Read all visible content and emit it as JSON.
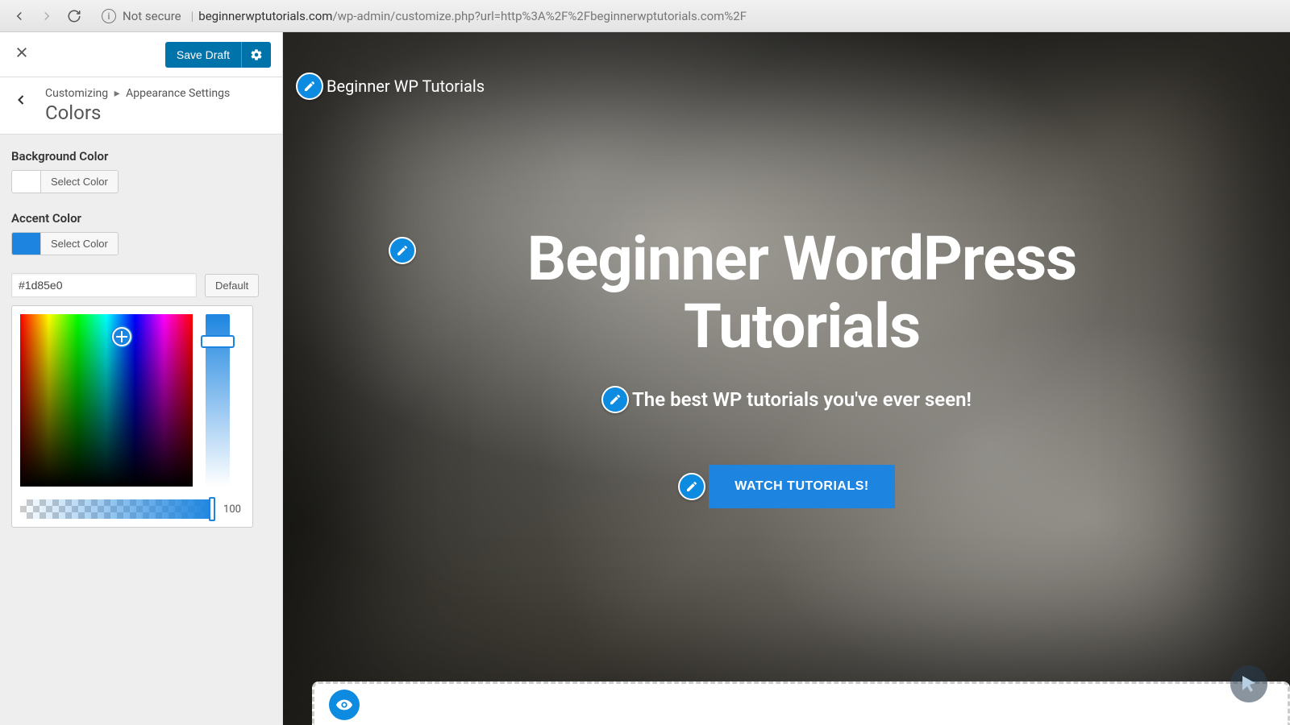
{
  "browser": {
    "not_secure": "Not secure",
    "host": "beginnerwptutorials.com",
    "path": "/wp-admin/customize.php?url=http%3A%2F%2Fbeginnerwptutorials.com%2F"
  },
  "header": {
    "save_draft": "Save Draft"
  },
  "breadcrumb": {
    "root": "Customizing",
    "parent": "Appearance Settings",
    "section": "Colors"
  },
  "controls": {
    "background": {
      "label": "Background Color",
      "select_btn": "Select Color",
      "swatch": "#ffffff"
    },
    "accent": {
      "label": "Accent Color",
      "select_btn": "Select Color",
      "swatch": "#1d85e0",
      "hex_value": "#1d85e0",
      "default_btn": "Default",
      "alpha": "100"
    }
  },
  "preview": {
    "site_title": "Beginner WP Tutorials",
    "hero_title": "Beginner WordPress Tutorials",
    "tagline": "The best WP tutorials you've ever seen!",
    "cta": "WATCH TUTORIALS!"
  },
  "colors": {
    "accent": "#1d85e0",
    "wp_blue": "#0073aa"
  }
}
